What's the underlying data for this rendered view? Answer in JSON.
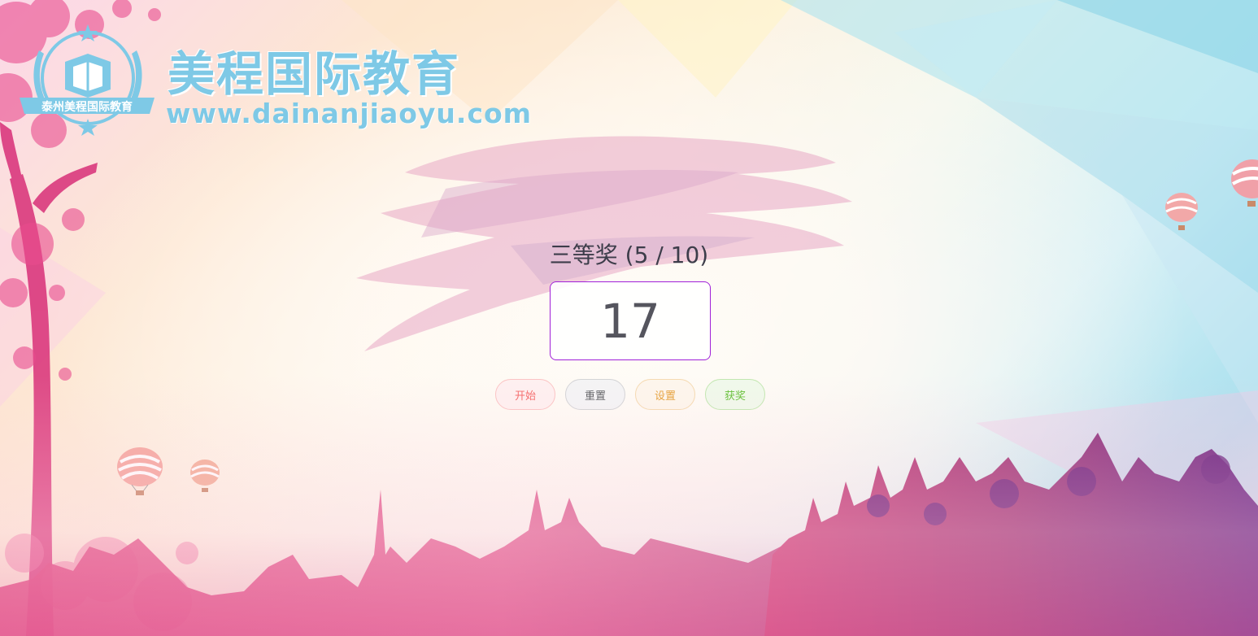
{
  "logo": {
    "title": "美程国际教育",
    "url": "www.dainanjiaoyu.com",
    "badge_text": "泰州美程国际教育",
    "badge_icon": "book-shield-icon"
  },
  "draw": {
    "prize_label": "三等奖 (5 / 10)",
    "current_number": "17"
  },
  "buttons": {
    "start": "开始",
    "reset": "重置",
    "settings": "设置",
    "winners": "获奖"
  },
  "colors": {
    "logo_blue": "#7ec9e6",
    "number_border": "#a020d8",
    "start": "#f56c6c",
    "reset": "#606266",
    "settings": "#e6a23c",
    "winners": "#67c23a"
  }
}
